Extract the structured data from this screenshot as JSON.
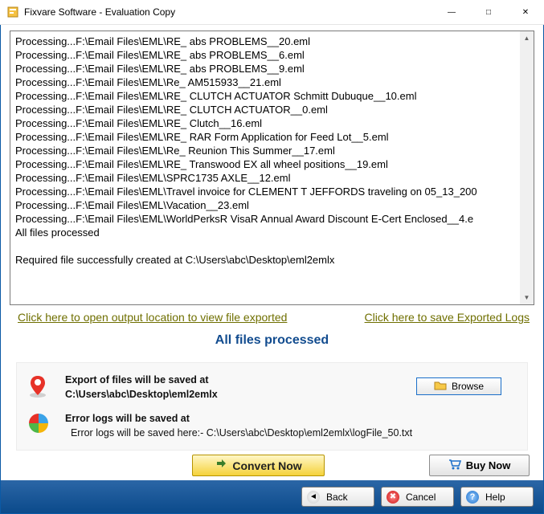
{
  "window": {
    "title": "Fixvare Software - Evaluation Copy"
  },
  "log": {
    "lines": [
      "Processing...F:\\Email Files\\EML\\RE_ abs PROBLEMS__20.eml",
      "Processing...F:\\Email Files\\EML\\RE_ abs PROBLEMS__6.eml",
      "Processing...F:\\Email Files\\EML\\RE_ abs PROBLEMS__9.eml",
      "Processing...F:\\Email Files\\EML\\Re_ AM515933__21.eml",
      "Processing...F:\\Email Files\\EML\\RE_ CLUTCH ACTUATOR Schmitt Dubuque__10.eml",
      "Processing...F:\\Email Files\\EML\\RE_ CLUTCH ACTUATOR__0.eml",
      "Processing...F:\\Email Files\\EML\\RE_ Clutch__16.eml",
      "Processing...F:\\Email Files\\EML\\RE_ RAR Form Application for Feed Lot__5.eml",
      "Processing...F:\\Email Files\\EML\\Re_ Reunion This Summer__17.eml",
      "Processing...F:\\Email Files\\EML\\RE_ Transwood EX all wheel positions__19.eml",
      "Processing...F:\\Email Files\\EML\\SPRC1735 AXLE__12.eml",
      "Processing...F:\\Email Files\\EML\\Travel invoice for CLEMENT T JEFFORDS traveling on 05_13_200",
      "Processing...F:\\Email Files\\EML\\Vacation__23.eml",
      "Processing...F:\\Email Files\\EML\\WorldPerksR VisaR Annual Award Discount E-Cert Enclosed__4.e",
      "All files processed",
      "",
      "Required file successfully created at C:\\Users\\abc\\Desktop\\eml2emlx"
    ]
  },
  "links": {
    "open_output": "Click here to open output location to view file exported",
    "save_logs": "Click here to save Exported Logs"
  },
  "status": "All files processed",
  "panel": {
    "export_label": "Export of files will be saved at",
    "export_path": "C:\\Users\\abc\\Desktop\\eml2emlx",
    "error_label": "Error logs will be saved at",
    "error_path": "  Error logs will be saved here:- C:\\Users\\abc\\Desktop\\eml2emlx\\logFile_50.txt",
    "browse": "Browse"
  },
  "actions": {
    "convert": "Convert Now",
    "buy": "Buy Now"
  },
  "footer": {
    "back": "Back",
    "cancel": "Cancel",
    "help": "Help"
  }
}
